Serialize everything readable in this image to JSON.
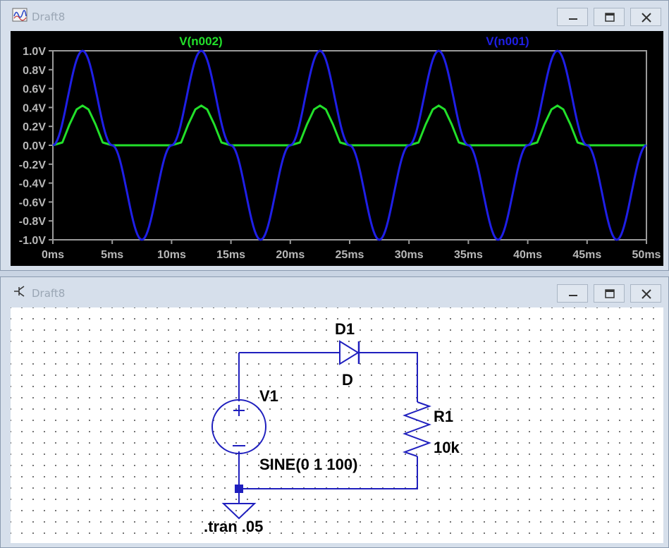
{
  "plot_window": {
    "title": "Draft8"
  },
  "schematic_window": {
    "title": "Draft8"
  },
  "window_controls": {
    "minimize": "minimize-icon",
    "maximize": "maximize-icon",
    "close": "close-icon"
  },
  "chart_data": {
    "type": "line",
    "xlabel": "",
    "ylabel": "",
    "xlim": [
      0,
      50
    ],
    "ylim": [
      -1.0,
      1.0
    ],
    "x_ticks": [
      "0ms",
      "5ms",
      "10ms",
      "15ms",
      "20ms",
      "25ms",
      "30ms",
      "35ms",
      "40ms",
      "45ms",
      "50ms"
    ],
    "y_ticks": [
      "1.0V",
      "0.8V",
      "0.6V",
      "0.4V",
      "0.2V",
      "0.0V",
      "-0.2V",
      "-0.4V",
      "-0.6V",
      "-0.8V",
      "-1.0V"
    ],
    "grid": false,
    "background": "#000000",
    "series": [
      {
        "name": "V(n002)",
        "color": "#22e02a",
        "description_of_values": "half-wave rectified sine, peak 0.42 V",
        "x": [
          0,
          0.8,
          1.4,
          2.0,
          2.5,
          3.0,
          3.6,
          4.2,
          5.0,
          10,
          10.8,
          11.4,
          12.0,
          12.5,
          13.0,
          13.6,
          14.2,
          15,
          20,
          20.8,
          21.4,
          22,
          22.5,
          23,
          23.6,
          24.2,
          25,
          30,
          30.8,
          31.4,
          32,
          32.5,
          33,
          33.6,
          34.2,
          35,
          40,
          40.8,
          41.4,
          42,
          42.5,
          43,
          43.6,
          44.2,
          45,
          50
        ],
        "values": [
          0,
          0.03,
          0.22,
          0.38,
          0.42,
          0.38,
          0.22,
          0.03,
          0,
          0,
          0.03,
          0.22,
          0.38,
          0.42,
          0.38,
          0.22,
          0.03,
          0,
          0,
          0.03,
          0.22,
          0.38,
          0.42,
          0.38,
          0.22,
          0.03,
          0,
          0,
          0.03,
          0.22,
          0.38,
          0.42,
          0.38,
          0.22,
          0.03,
          0,
          0,
          0.03,
          0.22,
          0.38,
          0.42,
          0.38,
          0.22,
          0.03,
          0,
          0
        ]
      },
      {
        "name": "V(n001)",
        "color": "#1f1fe6",
        "description_of_values": "sine, amplitude 1 V, 100 Hz",
        "x": [
          0,
          2.5,
          5,
          7.5,
          10,
          12.5,
          15,
          17.5,
          20,
          22.5,
          25,
          27.5,
          30,
          32.5,
          35,
          37.5,
          40,
          42.5,
          45,
          47.5,
          50
        ],
        "values": [
          0,
          1,
          0,
          -1,
          0,
          1,
          0,
          -1,
          0,
          1,
          0,
          -1,
          0,
          1,
          0,
          -1,
          0,
          1,
          0,
          -1,
          0
        ]
      }
    ]
  },
  "schematic": {
    "diode_name": "D1",
    "diode_model": "D",
    "source_name": "V1",
    "source_value": "SINE(0 1 100)",
    "resistor_name": "R1",
    "resistor_value": "10k",
    "directive": ".tran .05",
    "wire_color": "#1f1fbe"
  }
}
